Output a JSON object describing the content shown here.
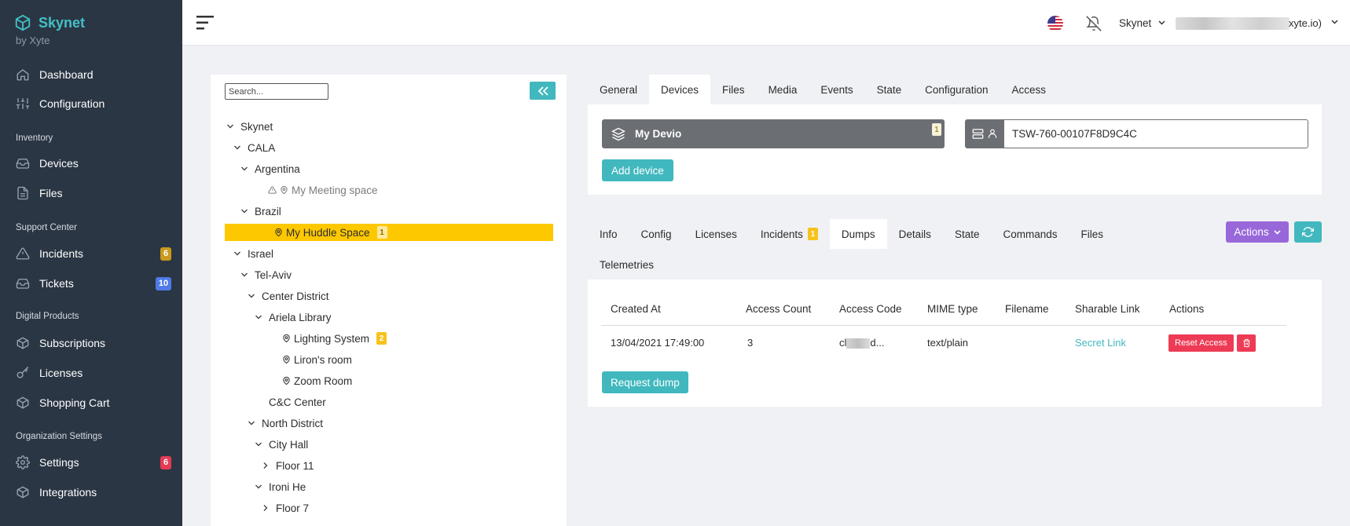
{
  "brand": {
    "name": "Skynet",
    "sub": "by Xyte"
  },
  "sidebar": {
    "items": [
      {
        "key": "dashboard",
        "label": "Dashboard",
        "icon": "home-icon"
      },
      {
        "key": "configuration",
        "label": "Configuration",
        "icon": "sliders-icon"
      },
      {
        "key": "devices",
        "label": "Devices",
        "icon": "inbox-icon"
      },
      {
        "key": "files",
        "label": "Files",
        "icon": "file-icon"
      },
      {
        "key": "incidents",
        "label": "Incidents",
        "icon": "warning-icon",
        "badge": "6"
      },
      {
        "key": "tickets",
        "label": "Tickets",
        "icon": "inbox-icon",
        "badge": "10"
      },
      {
        "key": "subscriptions",
        "label": "Subscriptions",
        "icon": "box-icon"
      },
      {
        "key": "licenses",
        "label": "Licenses",
        "icon": "key-icon"
      },
      {
        "key": "shopping-cart",
        "label": "Shopping Cart",
        "icon": "box-icon"
      },
      {
        "key": "settings",
        "label": "Settings",
        "icon": "gear-icon",
        "badge": "6"
      },
      {
        "key": "integrations",
        "label": "Integrations",
        "icon": "box-icon"
      }
    ],
    "sections": [
      "Inventory",
      "Support Center",
      "Digital Products",
      "Organization Settings"
    ]
  },
  "topbar": {
    "org": "Skynet",
    "email_suffix": "xyte.io)"
  },
  "tree": {
    "search_placeholder": "Search...",
    "nodes": [
      {
        "label": "Skynet",
        "level": 0,
        "toggle": "open"
      },
      {
        "label": "CALA",
        "level": 1,
        "toggle": "open"
      },
      {
        "label": "Argentina",
        "level": 2,
        "toggle": "open"
      },
      {
        "label": "My Meeting space",
        "level": 3,
        "toggle": "none",
        "space": true,
        "warn": true,
        "muted": true
      },
      {
        "label": "Brazil",
        "level": 2,
        "toggle": "open"
      },
      {
        "label": "My Huddle Space",
        "level": 3,
        "toggle": "none",
        "space": true,
        "selected": true,
        "badge": "1"
      },
      {
        "label": "Israel",
        "level": 1,
        "toggle": "open"
      },
      {
        "label": "Tel-Aviv",
        "level": 2,
        "toggle": "open"
      },
      {
        "label": "Center District",
        "level": 3,
        "toggle": "open"
      },
      {
        "label": "Ariela Library",
        "level": 4,
        "toggle": "open"
      },
      {
        "label": "Lighting System",
        "level": 5,
        "toggle": "none",
        "space": true,
        "badge": "2"
      },
      {
        "label": "Liron's room",
        "level": 5,
        "toggle": "none",
        "space": true
      },
      {
        "label": "Zoom Room",
        "level": 5,
        "toggle": "none",
        "space": true
      },
      {
        "label": "C&C Center",
        "level": 4,
        "toggle": "leaf"
      },
      {
        "label": "North District",
        "level": 3,
        "toggle": "open"
      },
      {
        "label": "City Hall",
        "level": 4,
        "toggle": "open"
      },
      {
        "label": "Floor 11",
        "level": 5,
        "toggle": "closed"
      },
      {
        "label": "Ironi He",
        "level": 4,
        "toggle": "open"
      },
      {
        "label": "Floor 7",
        "level": 5,
        "toggle": "closed"
      }
    ]
  },
  "top_tabs": [
    "General",
    "Devices",
    "Files",
    "Media",
    "Events",
    "State",
    "Configuration",
    "Access"
  ],
  "top_tabs_active": 1,
  "device": {
    "name": "My Devio",
    "badge": "1",
    "serial": "TSW-760-00107F8D9C4C",
    "add_label": "Add device"
  },
  "sub_tabs": [
    "Info",
    "Config",
    "Licenses",
    "Incidents",
    "Dumps",
    "Details",
    "State",
    "Commands",
    "Files"
  ],
  "sub_tabs_row2": [
    "Telemetries"
  ],
  "sub_tabs_active": 4,
  "incidents_badge": "1",
  "actions_label": "Actions",
  "dumps": {
    "headers": [
      "Created At",
      "Access Count",
      "Access Code",
      "MIME type",
      "Filename",
      "Sharable Link",
      "Actions"
    ],
    "row": {
      "created_at": "13/04/2021 17:49:00",
      "access_count": "3",
      "access_code_start": "cl",
      "access_code_end": "d...",
      "mime": "text/plain",
      "filename": "",
      "link": "Secret Link",
      "reset_label": "Reset Access"
    },
    "request_label": "Request dump"
  },
  "colors": {
    "accent": "#41b8be",
    "sidebar": "#2b3644",
    "selected": "#fec800",
    "danger": "#ee3b55",
    "purple": "#9868da",
    "brand": "#41c1c7"
  }
}
